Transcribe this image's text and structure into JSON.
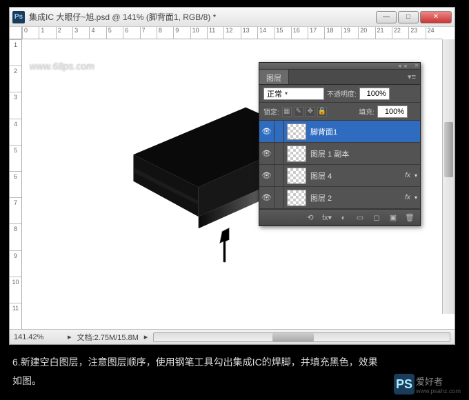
{
  "window": {
    "title": "集成IC     大眼仔~旭.psd @ 141% (脚背面1, RGB/8) *",
    "ps_icon_label": "Ps"
  },
  "win_controls": {
    "min": "—",
    "max": "□",
    "close": "✕"
  },
  "ruler_h": [
    "0",
    "1",
    "2",
    "3",
    "4",
    "5",
    "6",
    "7",
    "8",
    "9",
    "10",
    "11",
    "12",
    "13",
    "14",
    "15",
    "16",
    "17",
    "18",
    "19",
    "20",
    "21",
    "22",
    "23",
    "24"
  ],
  "ruler_v": [
    "1",
    "2",
    "3",
    "4",
    "5",
    "6",
    "7",
    "8",
    "9",
    "10",
    "11"
  ],
  "watermark": "www.68ps.com",
  "status": {
    "zoom": "141.42%",
    "doc": "文档:2.75M/15.8M"
  },
  "layers_panel": {
    "tab": "图层",
    "blend_mode": "正常",
    "opacity_label": "不透明度:",
    "opacity_value": "100%",
    "lock_label": "锁定:",
    "fill_label": "填充:",
    "fill_value": "100%",
    "lock_icons": [
      "▦",
      "✎",
      "✥",
      "🔒"
    ],
    "layers": [
      {
        "name": "脚背面1",
        "selected": true,
        "fx": false
      },
      {
        "name": "图层 1 副本",
        "selected": false,
        "fx": false
      },
      {
        "name": "图层 4",
        "selected": false,
        "fx": true
      },
      {
        "name": "图层 2",
        "selected": false,
        "fx": true
      }
    ],
    "footer_icons": [
      "⟲",
      "fx▾",
      "◐",
      "▭",
      "◻",
      "▣",
      "🗑"
    ]
  },
  "caption_text": "6.新建空白图层，注意图层顺序，使用钢笔工具勾出集成IC的焊脚，并填充黑色，效果如图。",
  "logo": {
    "big": "PS",
    "text": "爱好者",
    "sub": "www.psahz.com"
  }
}
